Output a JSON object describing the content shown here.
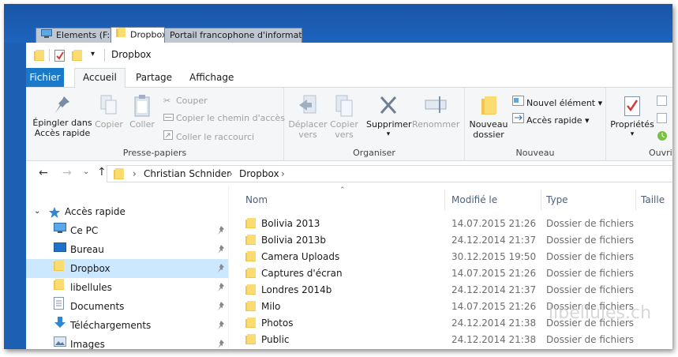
{
  "tabs": [
    {
      "label": "Elements (F:)",
      "icon": "drive-icon"
    },
    {
      "label": "Dropbox",
      "icon": "folder-icon",
      "active": true
    },
    {
      "label": "Portail francophone d'informatique - lib...",
      "icon": "none"
    }
  ],
  "qat": {
    "title": "Dropbox"
  },
  "menu": {
    "file": "Fichier",
    "home": "Accueil",
    "share": "Partage",
    "view": "Affichage"
  },
  "ribbon": {
    "clipboard": {
      "label": "Presse-papiers",
      "pin": "Épingler dans Accès rapide",
      "copy": "Copier",
      "paste": "Coller",
      "cut": "Couper",
      "copy_path": "Copier le chemin d'accès",
      "paste_shortcut": "Coller le raccourci"
    },
    "organize": {
      "label": "Organiser",
      "move_to": "Déplacer vers",
      "copy_to": "Copier vers",
      "delete": "Supprimer",
      "rename": "Renommer"
    },
    "new": {
      "label": "Nouveau",
      "new_folder": "Nouveau dossier",
      "new_item": "Nouvel élément",
      "easy_access": "Accès rapide"
    },
    "open": {
      "label": "Ouvri",
      "properties": "Propriétés"
    }
  },
  "address": {
    "crumbs": [
      "Christian Schnider",
      "Dropbox"
    ]
  },
  "nav": {
    "quick_access": "Accès rapide",
    "items": [
      {
        "label": "Ce PC",
        "icon": "monitor-icon"
      },
      {
        "label": "Bureau",
        "icon": "desktop-icon"
      },
      {
        "label": "Dropbox",
        "icon": "folder-icon",
        "selected": true
      },
      {
        "label": "libellules",
        "icon": "folder-icon"
      },
      {
        "label": "Documents",
        "icon": "documents-icon"
      },
      {
        "label": "Téléchargements",
        "icon": "download-icon"
      },
      {
        "label": "Images",
        "icon": "images-icon"
      }
    ]
  },
  "columns": {
    "name": "Nom",
    "modified": "Modifié le",
    "type": "Type",
    "size": "Taille"
  },
  "files": [
    {
      "name": "Bolivia 2013",
      "modified": "14.07.2015 21:26",
      "type": "Dossier de fichiers"
    },
    {
      "name": "Bolivia 2013b",
      "modified": "24.12.2014 21:37",
      "type": "Dossier de fichiers"
    },
    {
      "name": "Camera Uploads",
      "modified": "30.12.2015 19:50",
      "type": "Dossier de fichiers"
    },
    {
      "name": "Captures d'écran",
      "modified": "14.07.2015 21:26",
      "type": "Dossier de fichiers"
    },
    {
      "name": "Londres 2014b",
      "modified": "24.12.2014 21:37",
      "type": "Dossier de fichiers"
    },
    {
      "name": "Milo",
      "modified": "14.07.2015 21:26",
      "type": "Dossier de fichiers"
    },
    {
      "name": "Photos",
      "modified": "24.12.2014 21:38",
      "type": "Dossier de fichiers"
    },
    {
      "name": "Public",
      "modified": "24.12.2014 21:38",
      "type": "Dossier de fichiers"
    }
  ],
  "watermark": "libellules.ch",
  "colors": {
    "accent": "#1979ca",
    "selection": "#cce8ff",
    "folder": "#f4c64b",
    "frame": "#1d5fb2"
  }
}
